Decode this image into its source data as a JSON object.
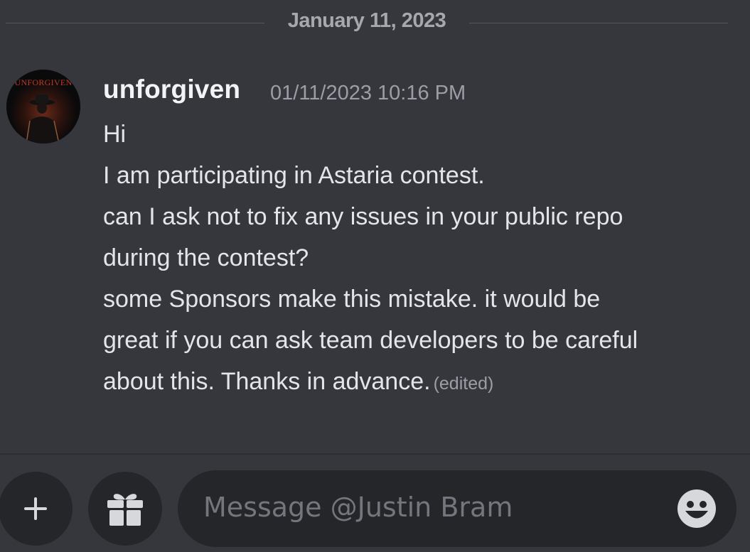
{
  "date_divider": {
    "label": "January 11, 2023"
  },
  "message": {
    "avatar_text": "UNFORGIVEN",
    "author": "unforgiven",
    "timestamp": "01/11/2023 10:16 PM",
    "lines": [
      "Hi",
      "I am participating in Astaria contest.",
      "can I ask not to fix any issues in your public repo",
      "during the contest?",
      "some Sponsors make this mistake. it would be",
      "great if you can ask team developers to be careful",
      "about this. Thanks in advance."
    ],
    "edited_label": "(edited)"
  },
  "composer": {
    "placeholder": "Message @Justin Bram",
    "icons": {
      "add": "plus-icon",
      "gift": "gift-icon",
      "emoji": "emoji-icon"
    }
  },
  "colors": {
    "background": "#36373d",
    "input_bg": "#25262a",
    "author": "#f2f3f5",
    "text": "#e3e5e9",
    "muted": "#9b9ea6",
    "avatar_text": "#c0392b"
  }
}
